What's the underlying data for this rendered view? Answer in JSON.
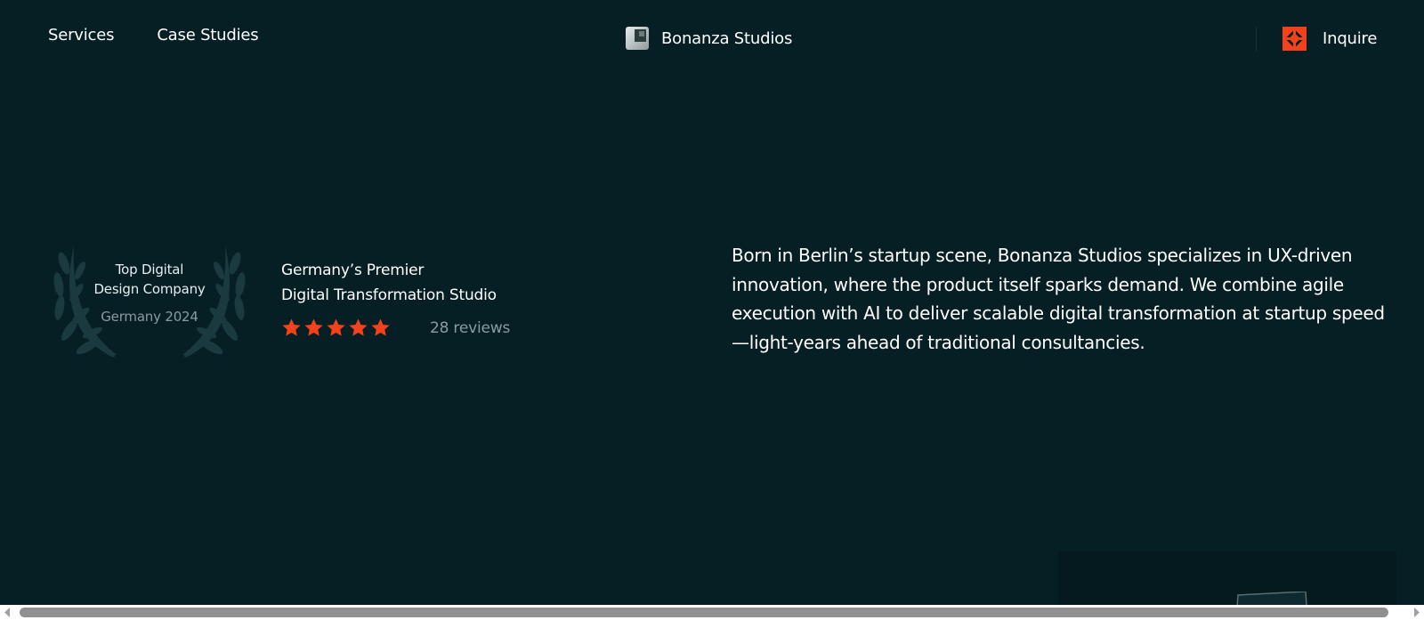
{
  "header": {
    "nav_left": [
      {
        "label": "Services"
      },
      {
        "label": "Case Studies"
      }
    ],
    "brand_name": "Bonanza Studios",
    "inquire_label": "Inquire"
  },
  "award": {
    "line1": "Top Digital",
    "line2": "Design Company",
    "year": "Germany 2024"
  },
  "premier": {
    "line1": "Germany’s Premier",
    "line2": "Digital Transformation Studio"
  },
  "rating": {
    "stars": 5,
    "reviews": "28 reviews"
  },
  "description": "Born in Berlin’s startup scene, Bonanza Studios specializes in UX-driven innovation, where the product itself sparks demand. We combine agile execution with AI to deliver scalable digital transformation at startup speed—light-years ahead of traditional consultancies.",
  "colors": {
    "background": "#061f24",
    "accent": "#f2421b",
    "muted_text": "#8a9ca0",
    "laurel": "#1a3a40"
  },
  "icons": {
    "brand_logo": "bonanza-logo-icon",
    "inquire": "inquire-icon",
    "star": "star-icon",
    "laurel": "laurel-wreath-icon"
  }
}
